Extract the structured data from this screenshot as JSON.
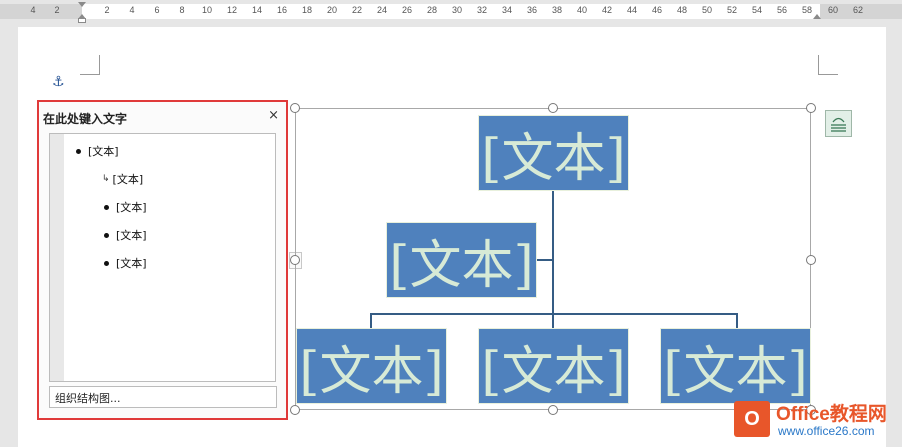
{
  "ruler": {
    "ticks": [
      "4",
      "2",
      "2",
      "4",
      "6",
      "8",
      "10",
      "12",
      "14",
      "16",
      "18",
      "20",
      "22",
      "24",
      "26",
      "28",
      "30",
      "32",
      "34",
      "36",
      "38",
      "40",
      "42",
      "44",
      "46",
      "48",
      "50",
      "52",
      "54",
      "56",
      "58",
      "60",
      "62"
    ]
  },
  "text_pane": {
    "title": "在此处键入文字",
    "close": "×",
    "items": [
      {
        "text": "[文本]",
        "level": 0,
        "bullet": "dot"
      },
      {
        "text": "[文本]",
        "level": 1,
        "bullet": "arrow"
      },
      {
        "text": "[文本]",
        "level": 1,
        "bullet": "dot"
      },
      {
        "text": "[文本]",
        "level": 1,
        "bullet": "dot"
      },
      {
        "text": "[文本]",
        "level": 1,
        "bullet": "dot"
      }
    ],
    "footer": "组织结构图..."
  },
  "expander_glyph": "›",
  "diagram": {
    "top": "[文本]",
    "assistant": "[文本]",
    "children": [
      "[文本]",
      "[文本]",
      "[文本]"
    ],
    "colors": {
      "box": "#4f81bd",
      "text": "#d7ead6",
      "line": "#355c84"
    }
  },
  "watermark": {
    "icon_letter": "O",
    "title": "Office教程网",
    "url": "www.office26.com"
  }
}
